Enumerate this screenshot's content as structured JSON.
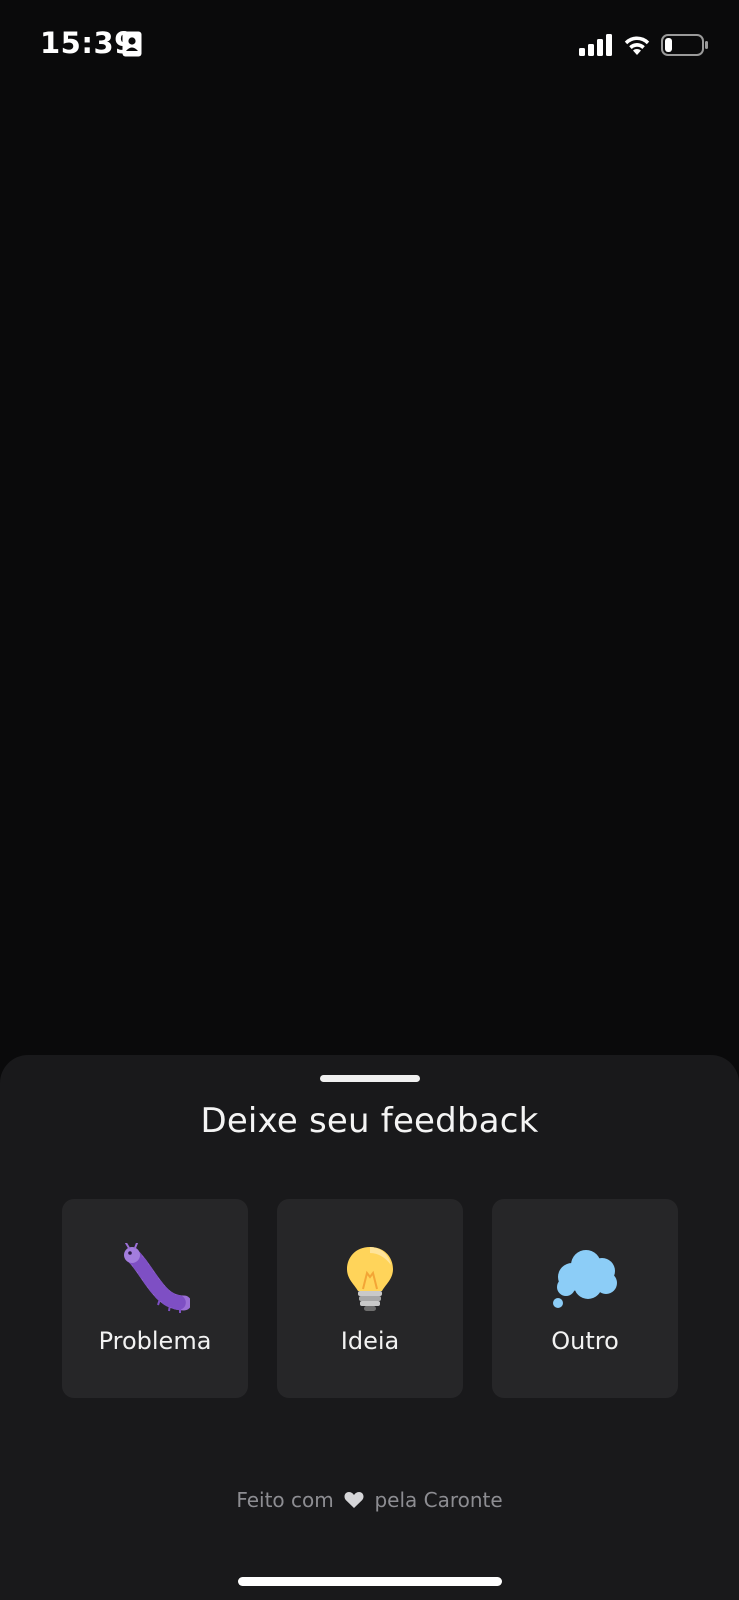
{
  "status_bar": {
    "time": "15:39",
    "icons": [
      "contact-card-icon",
      "signal-icon",
      "wifi-icon",
      "battery-icon"
    ],
    "battery_level": 0.2
  },
  "sheet": {
    "title": "Deixe seu feedback",
    "options": [
      {
        "label": "Problema",
        "icon": "bug-icon",
        "icon_color": "#9b6fd6"
      },
      {
        "label": "Ideia",
        "icon": "lightbulb-icon",
        "icon_color": "#ffd45a"
      },
      {
        "label": "Outro",
        "icon": "thought-bubble-icon",
        "icon_color": "#8ccdf7"
      }
    ],
    "footer": {
      "before": "Feito com",
      "after": "pela Caronte",
      "icon": "heart-icon"
    }
  },
  "colors": {
    "background": "#0a0a0b",
    "sheet": "#19191b",
    "card": "#262628",
    "footer_text": "#8d8d92"
  }
}
